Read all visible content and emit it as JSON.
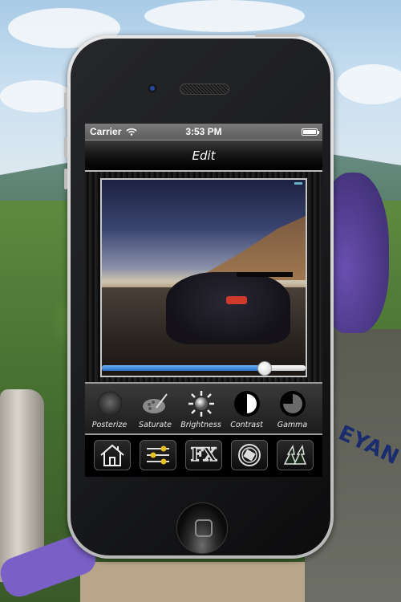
{
  "status_bar": {
    "carrier": "Carrier",
    "time": "3:53 PM",
    "wifi_icon": "wifi-icon",
    "battery_icon": "battery-icon"
  },
  "nav_bar": {
    "title": "Edit"
  },
  "editor": {
    "slider": {
      "value_fraction": 0.8
    },
    "tools": [
      {
        "label": "Posterize",
        "icon": "posterize-icon"
      },
      {
        "label": "Saturate",
        "icon": "palette-icon"
      },
      {
        "label": "Brightness",
        "icon": "sun-icon"
      },
      {
        "label": "Contrast",
        "icon": "contrast-icon"
      },
      {
        "label": "Gamma",
        "icon": "gamma-icon"
      },
      {
        "label": "",
        "icon": "crop-icon"
      }
    ]
  },
  "tab_bar": {
    "items": [
      {
        "name": "home",
        "icon": "home-icon"
      },
      {
        "name": "adjust",
        "icon": "sliders-icon"
      },
      {
        "name": "fx",
        "icon": "fx-icon",
        "text": "FX"
      },
      {
        "name": "rotate",
        "icon": "rotate-icon"
      },
      {
        "name": "share",
        "icon": "share-icon"
      }
    ]
  },
  "colors": {
    "slider_fill": "#2a70d0",
    "accent_yellow": "#e8c020"
  }
}
